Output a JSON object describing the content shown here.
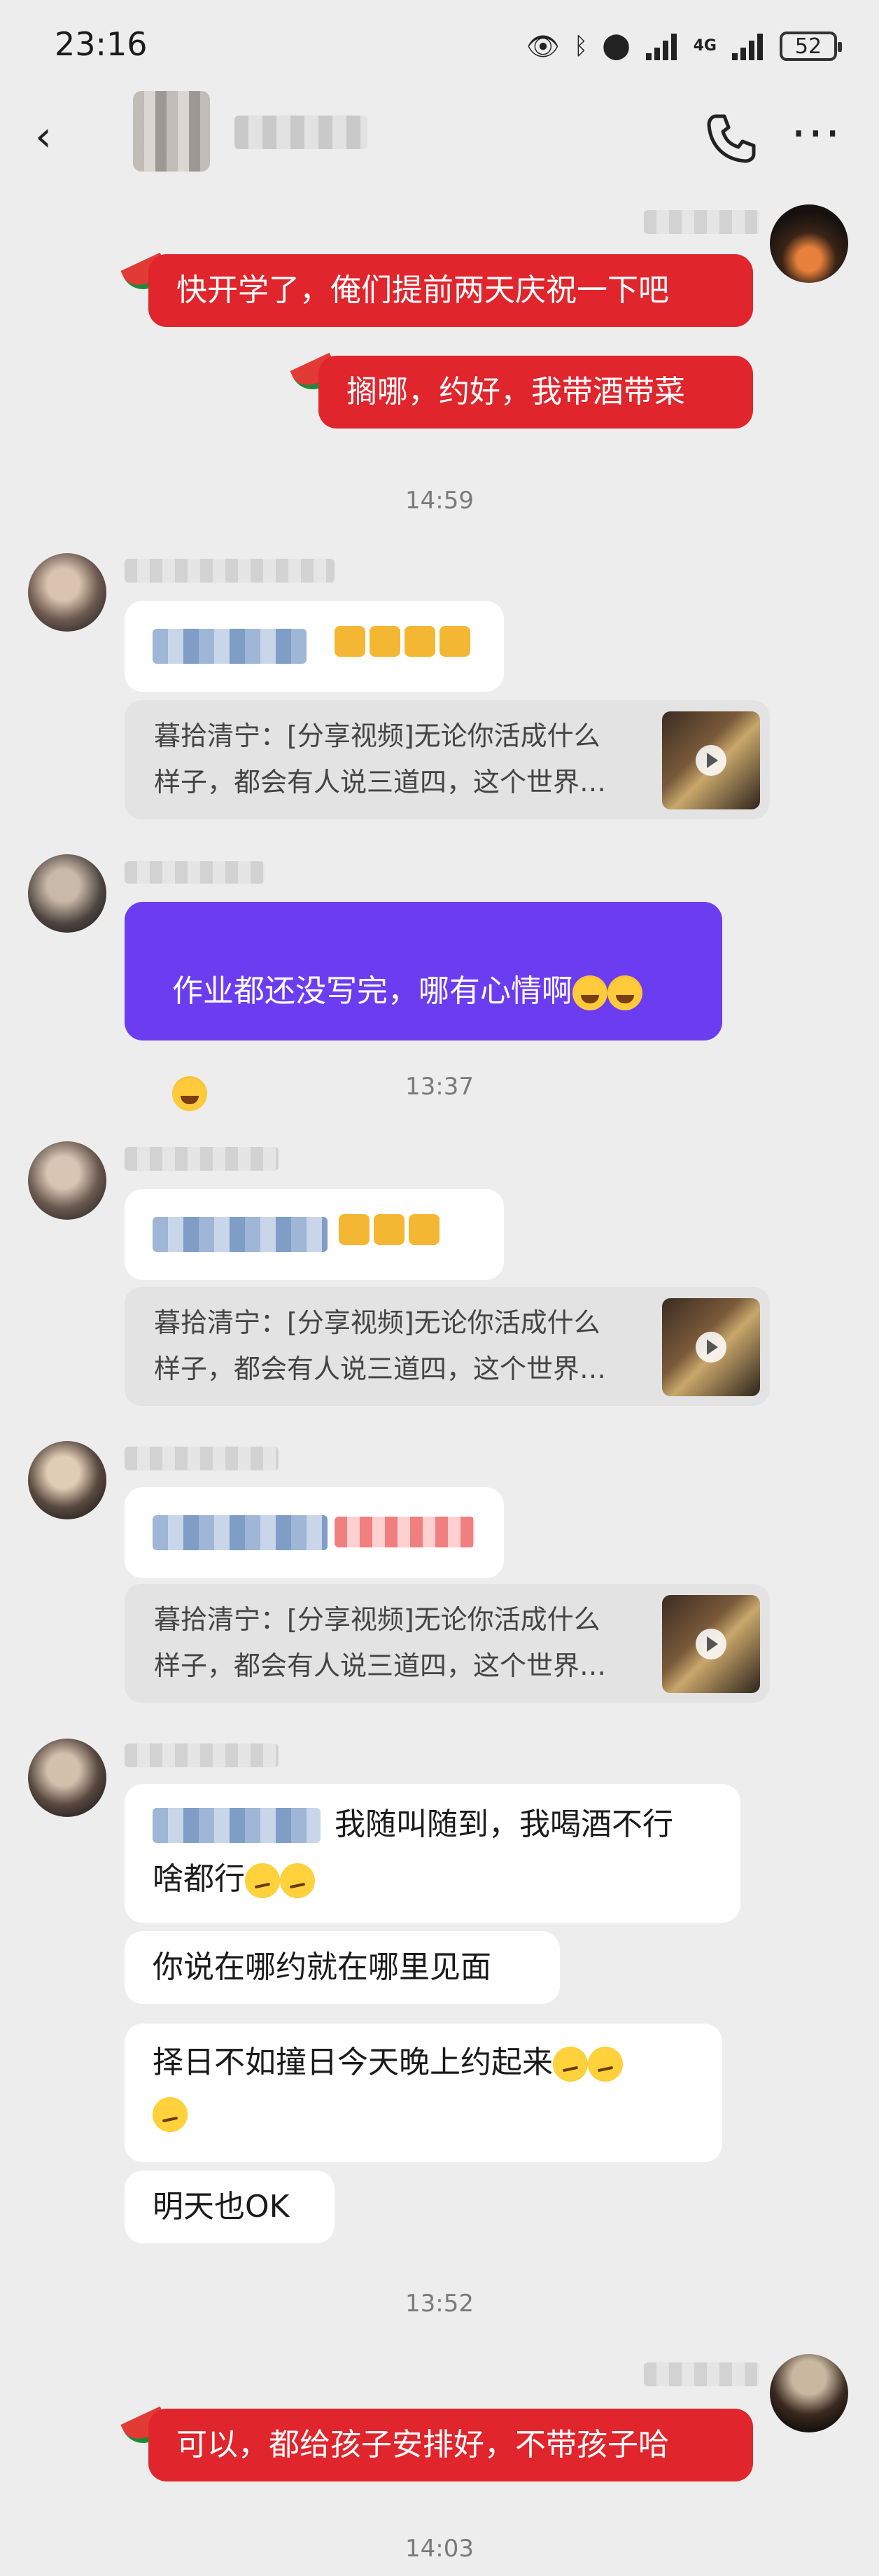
{
  "status_bar": {
    "time": "23:16",
    "network": "4G",
    "battery": "52",
    "icons": [
      "eye-icon",
      "bluetooth-icon",
      "location-icon",
      "signal-icon",
      "signal-4g-icon",
      "battery-icon"
    ]
  },
  "header": {
    "back_icon": "chevron-left-icon",
    "name_blurred": true,
    "call_icon": "phone-icon",
    "more_icon": "more-icon"
  },
  "messages": {
    "m1": "快开学了，俺们提前两天庆祝一下吧",
    "m2": "搁哪，约好，我带酒带菜",
    "ts1": "14:59",
    "card1_line1": "暮拾清宁：[分享视频]无论你活成什么",
    "card1_line2": "样子，都会有人说三道四，这个世界…",
    "m3_line1": "作业都还没写完，哪有心情啊",
    "ts2": "13:37",
    "card2_line1": "暮拾清宁：[分享视频]无论你活成什么",
    "card2_line2": "样子，都会有人说三道四，这个世界…",
    "card3_line1": "暮拾清宁：[分享视频]无论你活成什么",
    "card3_line2": "样子，都会有人说三道四，这个世界…",
    "m4_line1": "我随叫随到，我喝酒不行",
    "m4_line2": "啥都行",
    "m5": "你说在哪约就在哪里见面",
    "m6_line1": "择日不如撞日今天晚上约起来",
    "m7": "明天也OK",
    "ts3": "13:52",
    "m8": "可以，都给孩子安排好，不带孩子哈",
    "ts4": "14:03"
  },
  "colors": {
    "background": "#ededed",
    "red_bubble": "#e0252d",
    "purple_bubble": "#6c3df0",
    "white_bubble": "#ffffff",
    "card": "#e3e3e3"
  }
}
